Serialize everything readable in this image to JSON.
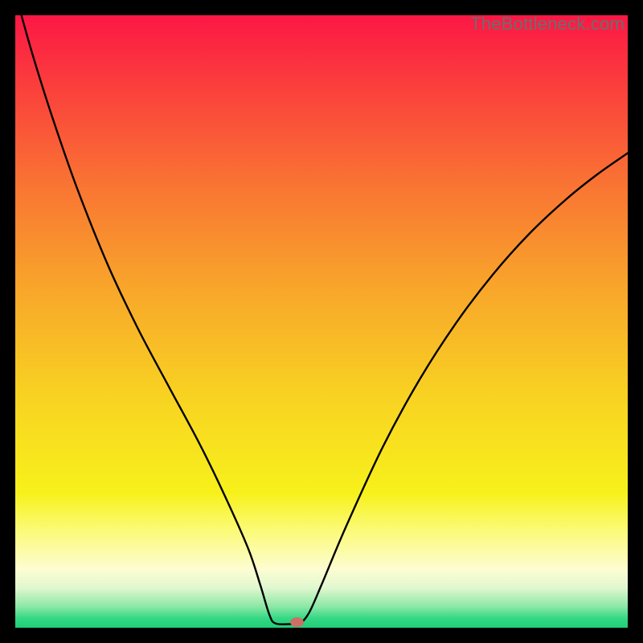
{
  "watermark": "TheBottleneck.com",
  "chart_data": {
    "type": "line",
    "title": "",
    "xlabel": "",
    "ylabel": "",
    "xlim": [
      0,
      100
    ],
    "ylim": [
      0,
      100
    ],
    "grid": false,
    "legend": false,
    "background_gradient": {
      "stops": [
        {
          "offset": 0.0,
          "color": "#fc1745"
        },
        {
          "offset": 0.12,
          "color": "#fb403c"
        },
        {
          "offset": 0.28,
          "color": "#f97533"
        },
        {
          "offset": 0.45,
          "color": "#f8a72a"
        },
        {
          "offset": 0.62,
          "color": "#f8d222"
        },
        {
          "offset": 0.78,
          "color": "#f7f11b"
        },
        {
          "offset": 0.84,
          "color": "#fbfa76"
        },
        {
          "offset": 0.905,
          "color": "#fdfdd2"
        },
        {
          "offset": 0.935,
          "color": "#e0f7cf"
        },
        {
          "offset": 0.965,
          "color": "#8de8a6"
        },
        {
          "offset": 0.985,
          "color": "#33d884"
        },
        {
          "offset": 1.0,
          "color": "#1fce77"
        }
      ]
    },
    "series": [
      {
        "name": "bottleneck-curve",
        "color": "#000000",
        "points": [
          {
            "x": 1.0,
            "y": 100.0
          },
          {
            "x": 3.0,
            "y": 93.0
          },
          {
            "x": 6.0,
            "y": 83.5
          },
          {
            "x": 10.0,
            "y": 72.0
          },
          {
            "x": 15.0,
            "y": 59.5
          },
          {
            "x": 20.0,
            "y": 48.9
          },
          {
            "x": 25.0,
            "y": 39.5
          },
          {
            "x": 30.0,
            "y": 30.2
          },
          {
            "x": 34.0,
            "y": 22.0
          },
          {
            "x": 38.0,
            "y": 13.0
          },
          {
            "x": 40.0,
            "y": 7.0
          },
          {
            "x": 41.5,
            "y": 2.1
          },
          {
            "x": 42.5,
            "y": 0.7
          },
          {
            "x": 45.0,
            "y": 0.6
          },
          {
            "x": 46.5,
            "y": 0.7
          },
          {
            "x": 48.0,
            "y": 2.5
          },
          {
            "x": 50.0,
            "y": 7.0
          },
          {
            "x": 54.0,
            "y": 16.5
          },
          {
            "x": 60.0,
            "y": 29.5
          },
          {
            "x": 66.0,
            "y": 40.5
          },
          {
            "x": 72.0,
            "y": 49.8
          },
          {
            "x": 78.0,
            "y": 57.7
          },
          {
            "x": 84.0,
            "y": 64.4
          },
          {
            "x": 90.0,
            "y": 70.0
          },
          {
            "x": 95.0,
            "y": 74.0
          },
          {
            "x": 100.0,
            "y": 77.5
          }
        ]
      }
    ],
    "marker": {
      "name": "optimal-point",
      "x": 46.0,
      "y": 0.9,
      "rx": 1.1,
      "ry": 0.8,
      "color": "#cb7063"
    }
  }
}
